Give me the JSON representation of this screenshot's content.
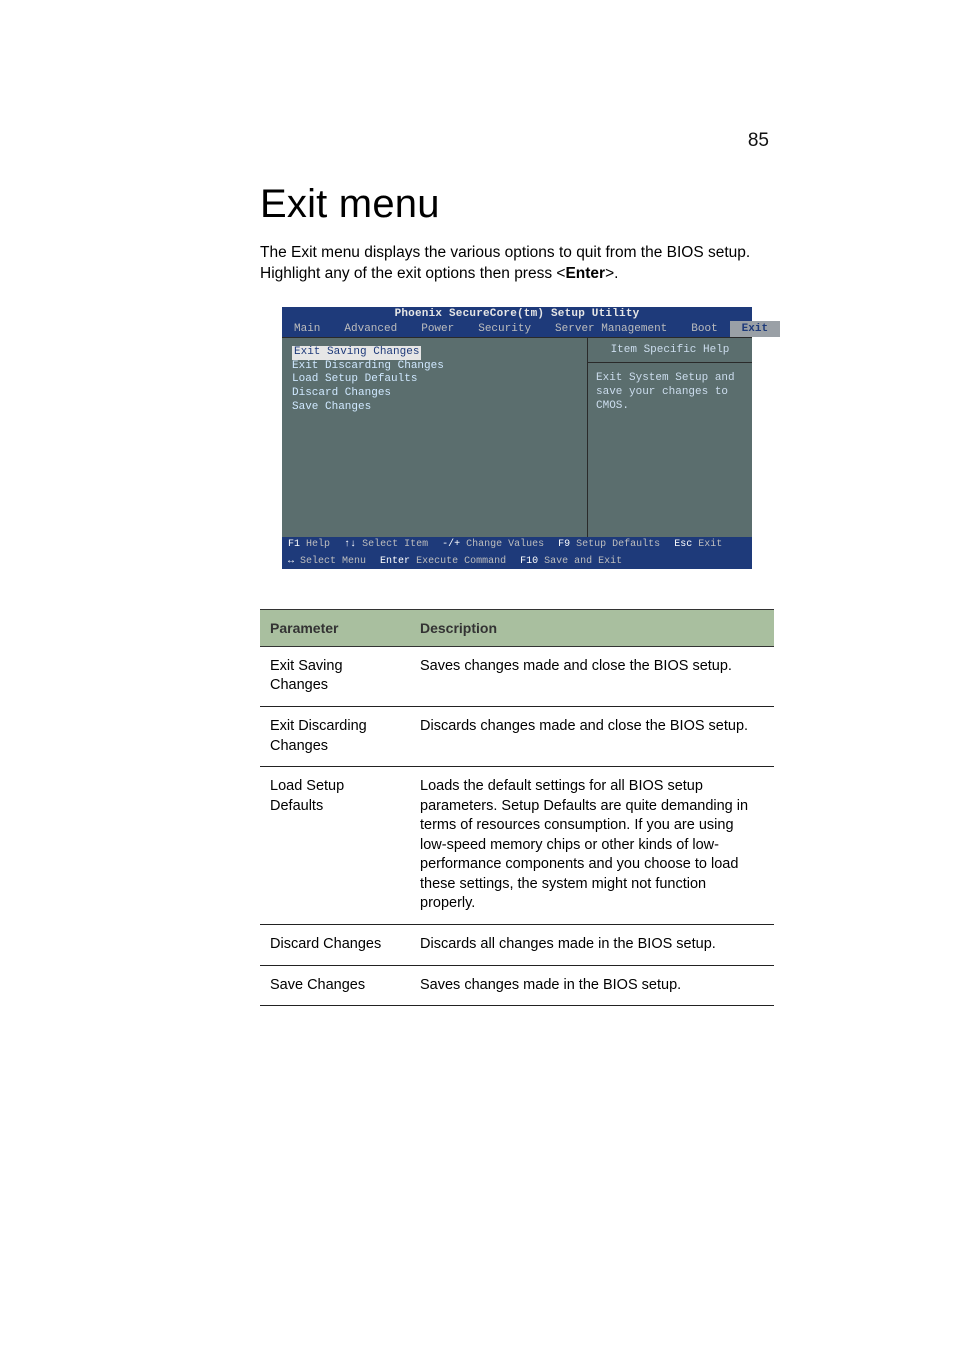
{
  "page_number": "85",
  "heading": "Exit menu",
  "intro_html": "The Exit menu displays the various options to quit from the BIOS setup. Highlight any of the exit options then press <<b>Enter</b>>.",
  "bios": {
    "title": "Phoenix SecureCore(tm) Setup Utility",
    "tabs": [
      "Main",
      "Advanced",
      "Power",
      "Security",
      "Server Management",
      "Boot",
      "Exit"
    ],
    "active_tab": "Exit",
    "left_selected": "Exit Saving Changes",
    "left_items": [
      "Exit Discarding Changes",
      "Load Setup Defaults",
      "Discard Changes",
      "Save Changes"
    ],
    "help_title": "Item Specific Help",
    "help_body": "Exit System Setup and save your changes to CMOS.",
    "footer": [
      {
        "k": "F1",
        "l": "Help"
      },
      {
        "k": "↑↓",
        "l": "Select Item"
      },
      {
        "k": "-/+",
        "l": "Change Values"
      },
      {
        "k": "F9",
        "l": "Setup Defaults"
      },
      {
        "k": "Esc",
        "l": "Exit"
      },
      {
        "k": "↔",
        "l": "Select Menu"
      },
      {
        "k": "Enter",
        "l": "Execute Command"
      },
      {
        "k": "F10",
        "l": "Save and Exit"
      }
    ]
  },
  "table": {
    "headers": {
      "param": "Parameter",
      "desc": "Description"
    },
    "rows": [
      {
        "param": "Exit Saving Changes",
        "desc": "Saves changes made and close the BIOS setup."
      },
      {
        "param": "Exit Discarding Changes",
        "desc": "Discards changes made and close the BIOS setup."
      },
      {
        "param": "Load Setup Defaults",
        "desc": "Loads the default settings for all BIOS setup parameters. Setup Defaults are quite demanding in terms of resources consumption. If you are using low-speed memory chips or other kinds of low-performance components and you choose to load these settings, the system might not function properly."
      },
      {
        "param": "Discard Changes",
        "desc": "Discards all changes made in the BIOS setup."
      },
      {
        "param": "Save Changes",
        "desc": "Saves changes made in the BIOS setup."
      }
    ]
  }
}
